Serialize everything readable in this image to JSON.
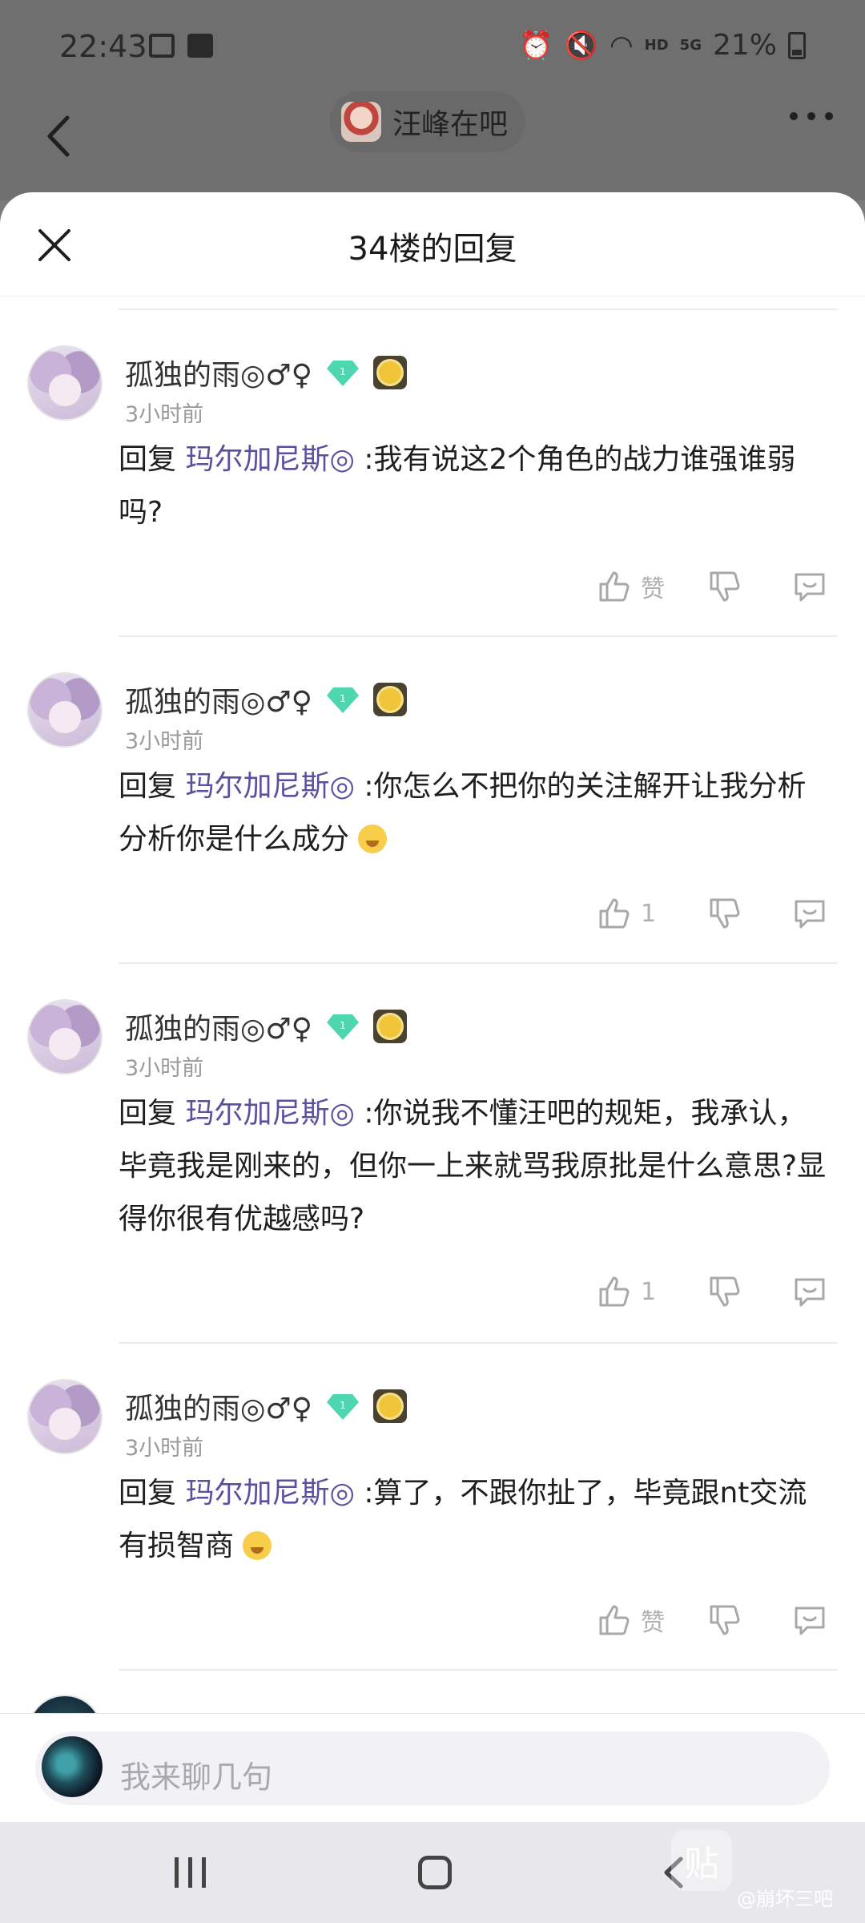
{
  "status_bar": {
    "time": "22:43",
    "network": "HD",
    "network_type": "5G",
    "battery": "21%"
  },
  "nav": {
    "forum_name": "汪峰在吧"
  },
  "sheet": {
    "title": "34楼的回复"
  },
  "replies": [
    {
      "username": "孤独的雨◎♂♀",
      "level": "1",
      "time": "3小时前",
      "prefix": "回复 ",
      "mention": "玛尔加尼斯◎",
      "text": " :我有说这2个角色的战力谁强谁弱吗?",
      "has_emoji": false,
      "like_label": "赞"
    },
    {
      "username": "孤独的雨◎♂♀",
      "level": "1",
      "time": "3小时前",
      "prefix": "回复 ",
      "mention": "玛尔加尼斯◎",
      "text": " :你怎么不把你的关注解开让我分析分析你是什么成分",
      "has_emoji": true,
      "like_label": "1"
    },
    {
      "username": "孤独的雨◎♂♀",
      "level": "1",
      "time": "3小时前",
      "prefix": "回复 ",
      "mention": "玛尔加尼斯◎",
      "text": " :你说我不懂汪吧的规矩，我承认，毕竟我是刚来的，但你一上来就骂我原批是什么意思?显得你很有优越感吗?",
      "has_emoji": false,
      "like_label": "1"
    },
    {
      "username": "孤独的雨◎♂♀",
      "level": "1",
      "time": "3小时前",
      "prefix": "回复 ",
      "mention": "玛尔加尼斯◎",
      "text": " :算了，不跟你扯了，毕竟跟nt交流有损智商",
      "has_emoji": true,
      "like_label": "赞"
    }
  ],
  "input": {
    "placeholder": "我来聊几句"
  },
  "watermark": {
    "glyph": "贴",
    "text": "@崩坏三吧"
  }
}
